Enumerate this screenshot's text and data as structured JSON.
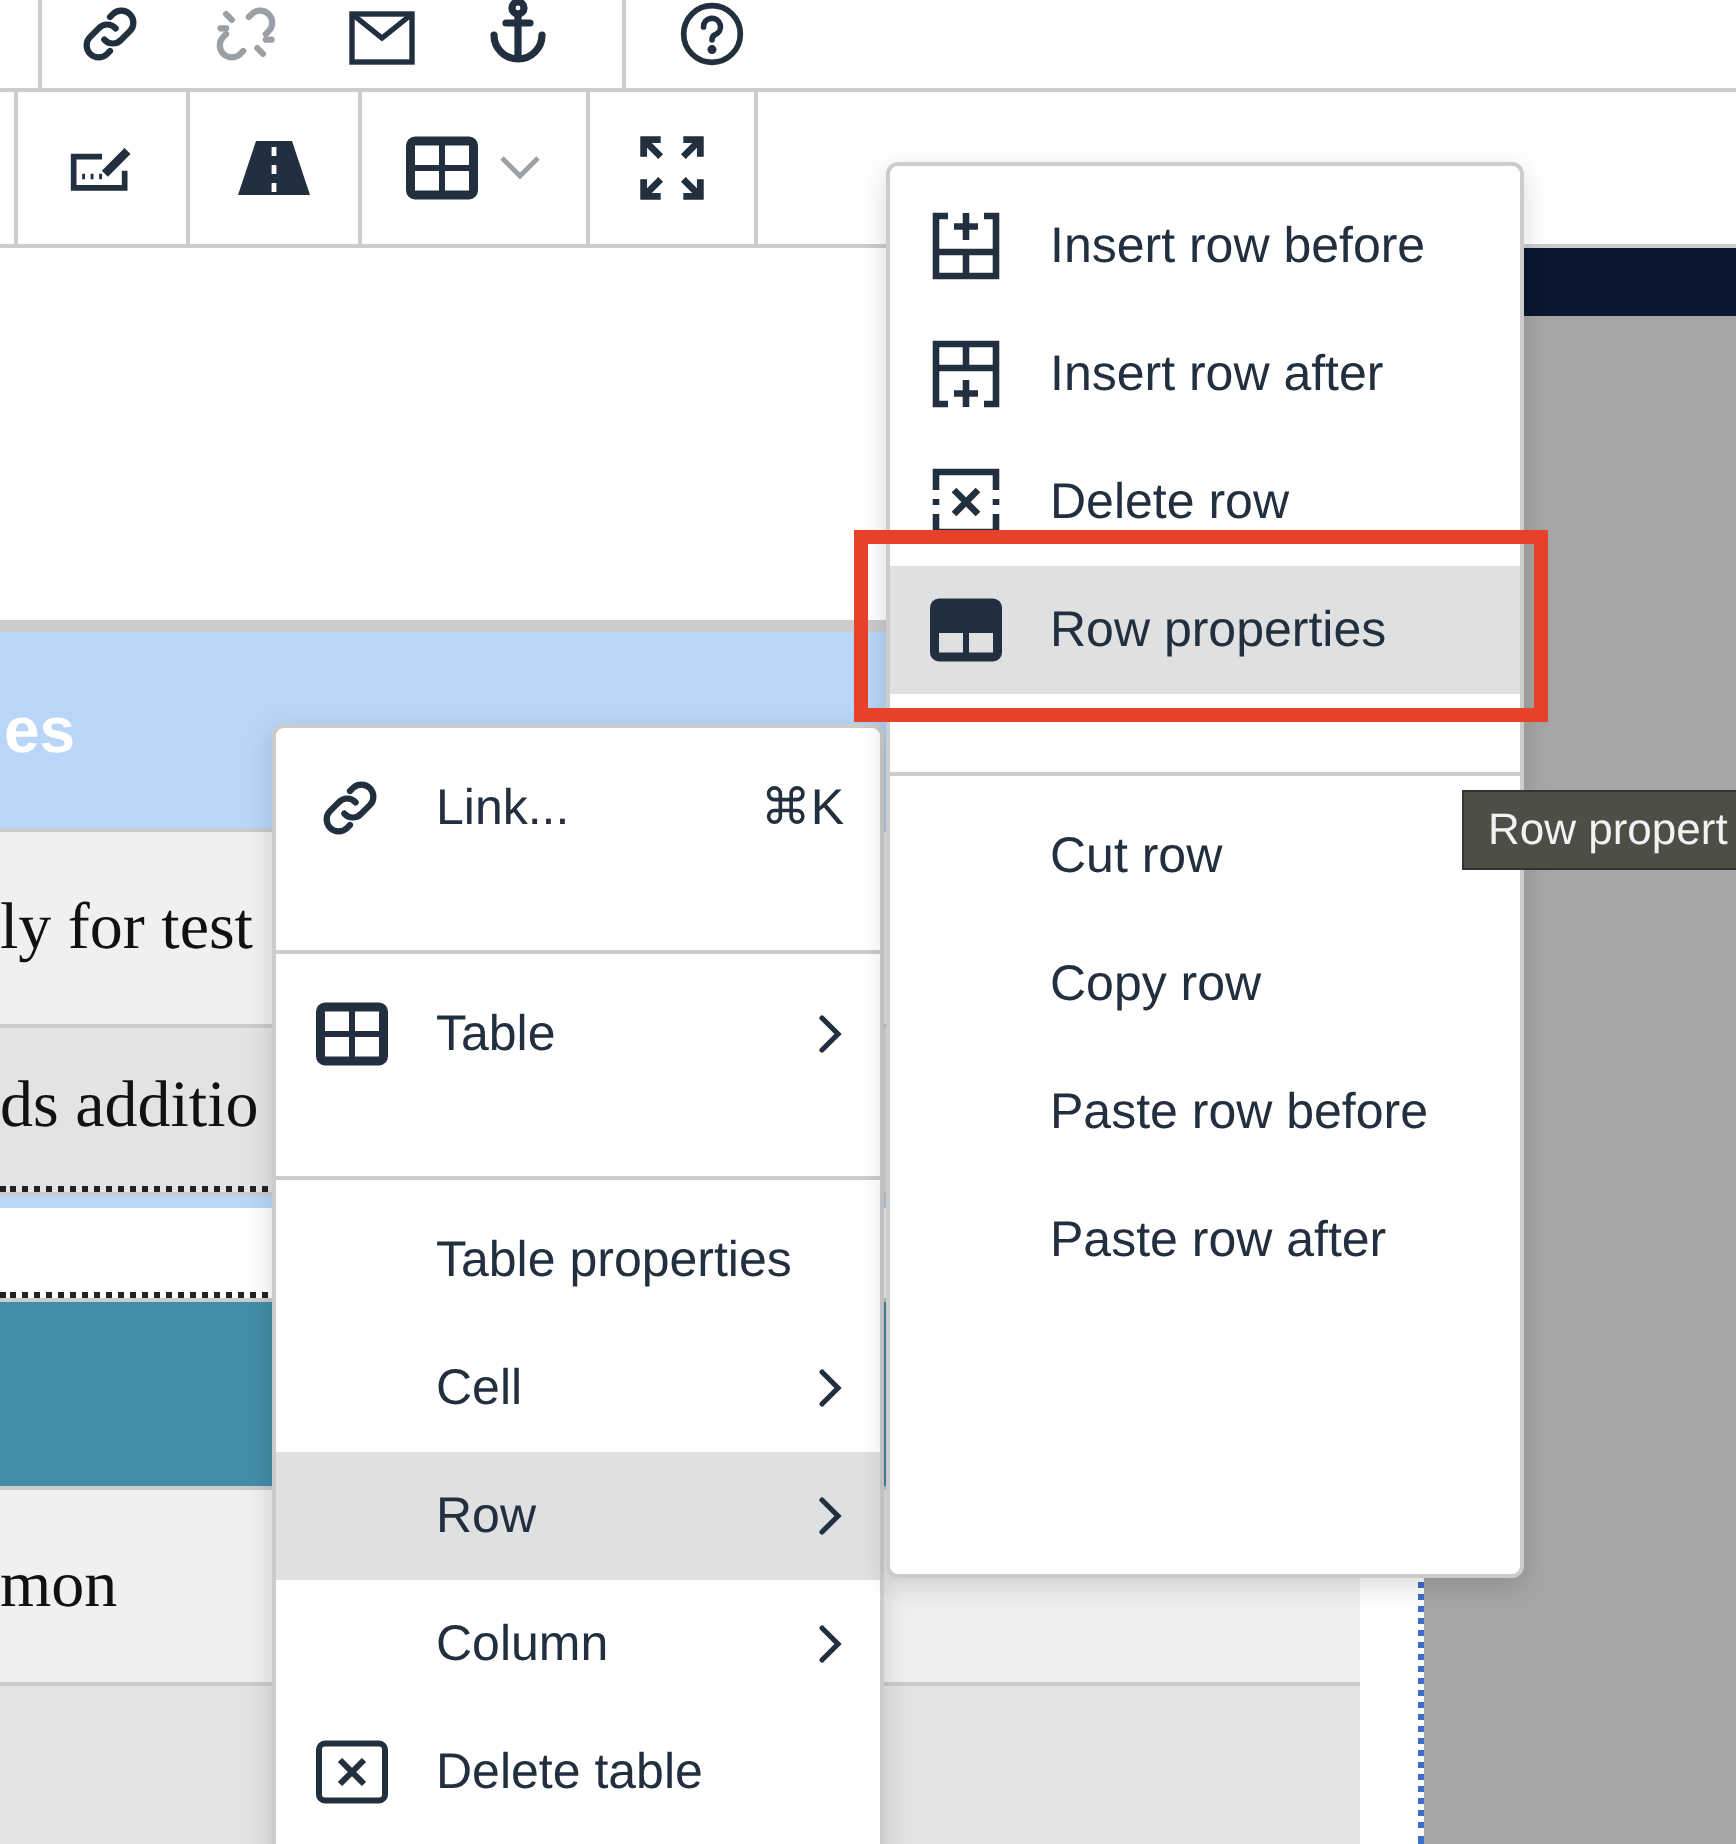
{
  "toolbar": {
    "rows": [
      {
        "items": [
          {
            "kind": "link",
            "disabled": false
          },
          {
            "kind": "unlink",
            "disabled": true
          },
          {
            "kind": "email",
            "disabled": false
          },
          {
            "kind": "anchor",
            "disabled": false
          },
          {
            "kind": "help",
            "disabled": false
          }
        ]
      },
      {
        "items": [
          {
            "kind": "signature",
            "disabled": false
          },
          {
            "kind": "road",
            "disabled": false
          },
          {
            "kind": "table",
            "disabled": false
          },
          {
            "kind": "fullscreen",
            "disabled": false
          }
        ]
      }
    ]
  },
  "table": {
    "rows": [
      {
        "kind": "header",
        "text": "es"
      },
      {
        "kind": "light",
        "text": "ly for test"
      },
      {
        "kind": "grey",
        "text": "ds additio"
      },
      {
        "kind": "blank"
      },
      {
        "kind": "accent"
      },
      {
        "kind": "light",
        "text": "mon"
      },
      {
        "kind": "grey"
      }
    ]
  },
  "context_menu": {
    "groups": [
      {
        "items": [
          {
            "label": "Link...",
            "kind": "link",
            "shortcut": "⌘K",
            "has_submenu": false,
            "selected": false
          }
        ]
      },
      {
        "items": [
          {
            "label": "Table",
            "kind": "table",
            "has_submenu": true,
            "selected": false
          }
        ]
      },
      {
        "items": [
          {
            "label": "Table properties",
            "has_submenu": false,
            "selected": false
          },
          {
            "label": "Cell",
            "has_submenu": true,
            "selected": false
          },
          {
            "label": "Row",
            "has_submenu": true,
            "selected": true
          },
          {
            "label": "Column",
            "has_submenu": true,
            "selected": false
          },
          {
            "label": "Delete table",
            "kind": "delete-table",
            "has_submenu": false,
            "selected": false
          }
        ]
      }
    ]
  },
  "submenu": {
    "groups": [
      {
        "items": [
          {
            "label": "Insert row before",
            "kind": "row-before",
            "selected": false
          },
          {
            "label": "Insert row after",
            "kind": "row-after",
            "selected": false
          },
          {
            "label": "Delete row",
            "kind": "row-delete",
            "selected": false
          },
          {
            "label": "Row properties",
            "kind": "row-props",
            "selected": true
          }
        ]
      },
      {
        "items": [
          {
            "label": "Cut row",
            "selected": false
          },
          {
            "label": "Copy row",
            "selected": false
          },
          {
            "label": "Paste row before",
            "selected": false
          },
          {
            "label": "Paste row after",
            "selected": false
          }
        ]
      }
    ]
  },
  "tooltip": {
    "text": "Row propert"
  }
}
